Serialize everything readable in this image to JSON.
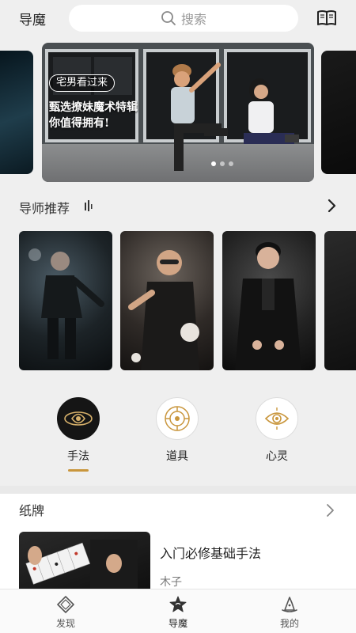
{
  "header": {
    "app_title": "导魔",
    "search_placeholder": "搜索",
    "book_icon": "book-open-icon"
  },
  "banner": {
    "tag": "宅男看过来",
    "line1": "甄选撩妹魔术特辑",
    "line2": "你值得拥有!",
    "page_count": 3,
    "active_page": 1
  },
  "mentors_section": {
    "title": "导师推荐"
  },
  "categories": [
    {
      "label": "手法",
      "icon": "sleight-of-hand-emblem-icon",
      "selected": true
    },
    {
      "label": "道具",
      "icon": "props-emblem-icon",
      "selected": false
    },
    {
      "label": "心灵",
      "icon": "mind-eye-emblem-icon",
      "selected": false
    }
  ],
  "cards_section": {
    "title": "纸牌",
    "lesson_title": "入门必修基础手法",
    "lesson_author": "木子"
  },
  "tabbar": {
    "tabs": [
      {
        "label": "发现",
        "icon": "diamond-compass-icon"
      },
      {
        "label": "导魔",
        "icon": "wizard-star-icon"
      },
      {
        "label": "我的",
        "icon": "wizard-hat-icon"
      }
    ],
    "active": "导魔"
  },
  "colors": {
    "accent": "#c9963c",
    "background": "#efefef"
  }
}
